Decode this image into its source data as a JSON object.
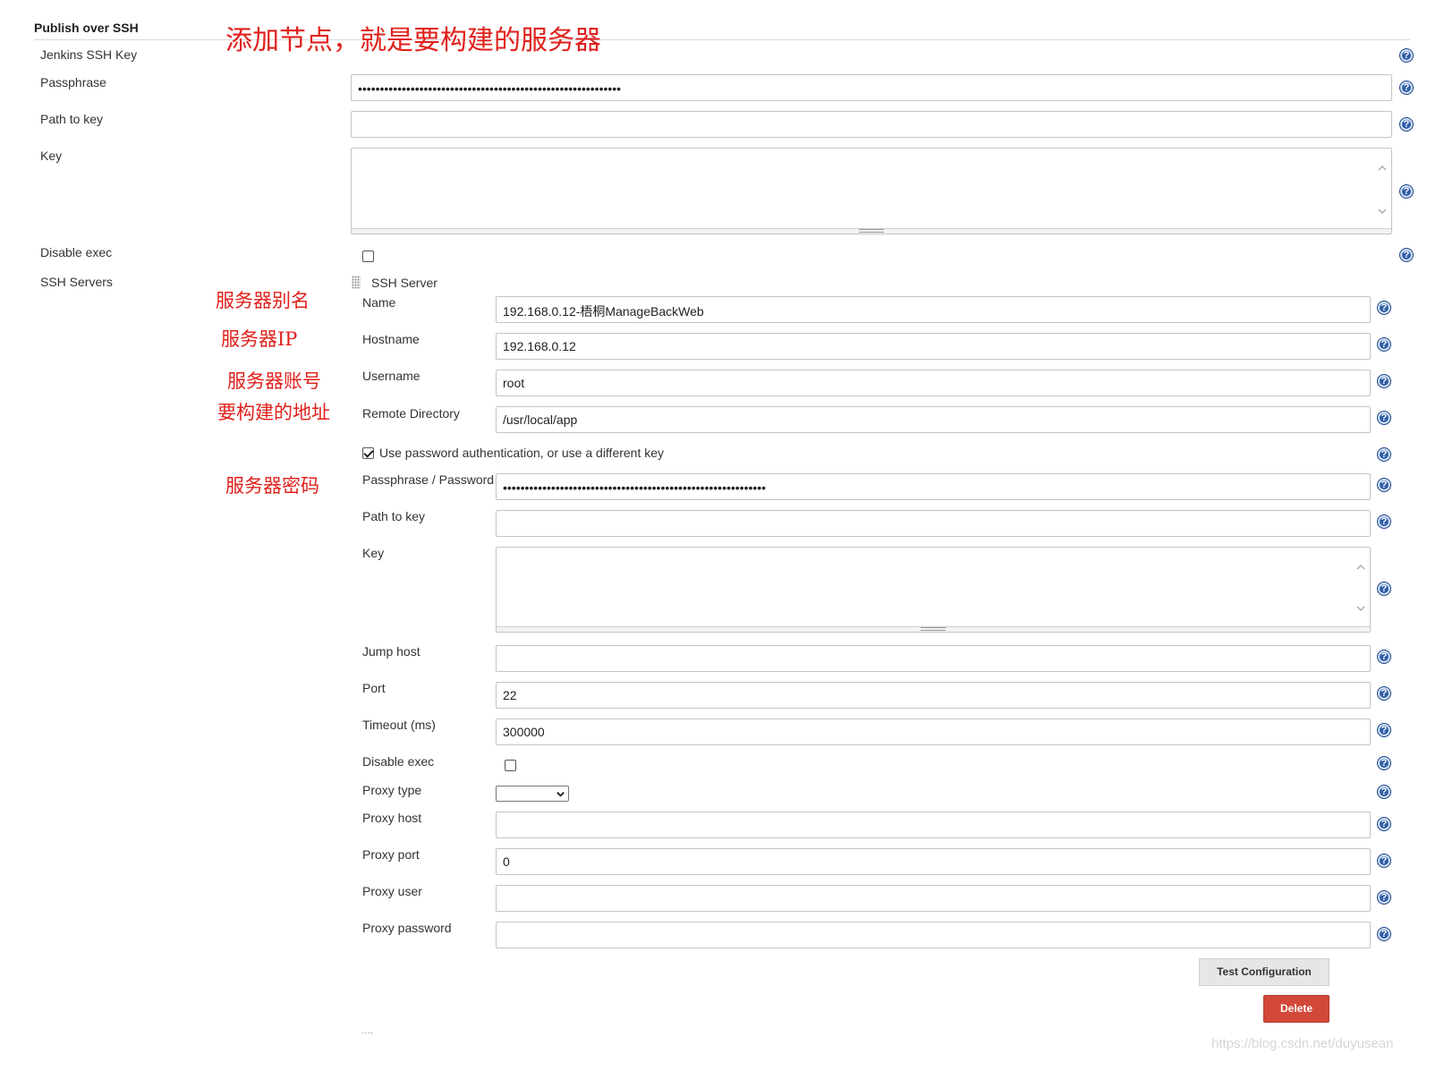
{
  "section": {
    "title": "Publish over SSH"
  },
  "global": {
    "jenkins_ssh_key_label": "Jenkins SSH Key",
    "passphrase_label": "Passphrase",
    "passphrase_value": "••••••••••••••••••••••••••••••••••••••••••••••••••••••••••••",
    "path_to_key_label": "Path to key",
    "path_to_key_value": "",
    "key_label": "Key",
    "disable_exec_label": "Disable exec",
    "ssh_servers_label": "SSH Servers"
  },
  "server": {
    "header": "SSH Server",
    "name_label": "Name",
    "name_value": "192.168.0.12-梧桐ManageBackWeb",
    "hostname_label": "Hostname",
    "hostname_value": "192.168.0.12",
    "username_label": "Username",
    "username_value": "root",
    "remote_dir_label": "Remote Directory",
    "remote_dir_value": "/usr/local/app",
    "use_password_label": "Use password authentication, or use a different key",
    "use_password_checked": true,
    "password_label": "Passphrase / Password",
    "password_value": "••••••••••••••••••••••••••••••••••••••••••••••••••••••••••••",
    "path_to_key_label": "Path to key",
    "path_to_key_value": "",
    "key_label": "Key",
    "jump_host_label": "Jump host",
    "jump_host_value": "",
    "port_label": "Port",
    "port_value": "22",
    "timeout_label": "Timeout (ms)",
    "timeout_value": "300000",
    "disable_exec_label": "Disable exec",
    "proxy_type_label": "Proxy type",
    "proxy_type_value": "",
    "proxy_host_label": "Proxy host",
    "proxy_host_value": "",
    "proxy_port_label": "Proxy port",
    "proxy_port_value": "0",
    "proxy_user_label": "Proxy user",
    "proxy_user_value": "",
    "proxy_password_label": "Proxy password",
    "proxy_password_value": "",
    "test_button": "Test Configuration",
    "delete_button": "Delete"
  },
  "annotations": {
    "add_node": "添加节点，就是要构建的服务器",
    "server_alias": "服务器别名",
    "server_ip": "服务器IP",
    "server_account": "服务器账号",
    "build_address": "要构建的地址",
    "server_password": "服务器密码"
  },
  "footer": {
    "ellipsis": "....",
    "watermark": "https://blog.csdn.net/duyusean"
  },
  "icons": {
    "help": "help-icon",
    "textarea_scroll_up": "chevron-up-icon",
    "textarea_scroll_down": "chevron-down-icon",
    "drag": "drag-handle-icon",
    "select_arrow": "chevron-down-icon"
  },
  "colors": {
    "annotation_red": "#e0201b",
    "delete_button": "#d24939",
    "help_icon": "#2f5fa8"
  }
}
